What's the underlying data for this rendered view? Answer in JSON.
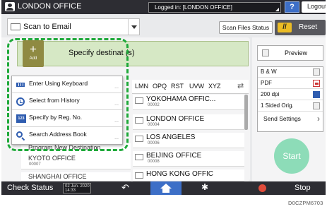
{
  "topbar": {
    "title": "LONDON OFFICE",
    "logged_in": "Logged in: [LONDON OFFICE]",
    "help": "?",
    "logout": "Logout"
  },
  "header": {
    "scan_to": "Scan to Email",
    "scan_files_status": "Scan Files Status",
    "reset": "Reset"
  },
  "destination": {
    "label": "Specify destinat     (s)",
    "add_label": "Add",
    "add_symbol": "+"
  },
  "tabs": [
    "LMN",
    "OPQ",
    "RST",
    "UVW",
    "XYZ"
  ],
  "entries": [
    {
      "name": "YOKOHAMA OFFIC...",
      "num": "00002"
    },
    {
      "name": "LONDON OFFICE",
      "num": "00004"
    },
    {
      "name": "LOS ANGELES",
      "num": "00006"
    },
    {
      "name": "BEIJING OFFICE",
      "num": "00008"
    },
    {
      "name": "HONG KONG OFFIC",
      "num": ""
    }
  ],
  "under_entries": [
    {
      "name": "Program New Destination",
      "num": ""
    },
    {
      "name": "KYOTO OFFICE",
      "num": "00007"
    },
    {
      "name": "SHANGHAI OFFICE",
      "num": ""
    }
  ],
  "menu": {
    "items": [
      {
        "label": "Enter Using Keyboard",
        "icon": "keyboard-icon"
      },
      {
        "label": "Select from History",
        "icon": "clock-icon"
      },
      {
        "label": "Specify by Reg. No.",
        "icon": "reg-number-icon",
        "icon_text": "123"
      },
      {
        "label": "Search Address Book",
        "icon": "search-icon"
      }
    ],
    "dots": "..."
  },
  "settings": {
    "preview": "Preview",
    "rows": [
      "B & W",
      "PDF",
      "200 dpi",
      "1 Sided Orig."
    ],
    "send_settings": "Send Settings",
    "start": "Start"
  },
  "bottombar": {
    "check_status": "Check Status",
    "date": "02 Jun. 2020",
    "time": "14:33",
    "stop": "Stop"
  },
  "figure_code": "D0CZPM6703",
  "colors": {
    "highlight": "#1fa93a",
    "dest_bar": "#d6e8c5",
    "add_button": "#8f8a42",
    "accent_blue": "#3d6fc7",
    "reset_icon": "#ebbc25",
    "start": "#8ddcb8",
    "stop": "#e14c3b"
  }
}
